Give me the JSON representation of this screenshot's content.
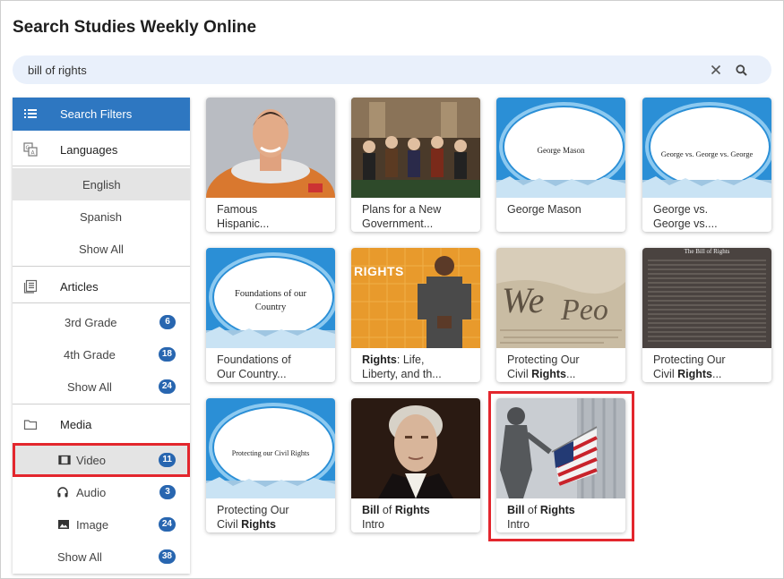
{
  "page": {
    "title": "Search Studies Weekly Online"
  },
  "search": {
    "value": "bill of rights"
  },
  "sidebar": {
    "filters_label": "Search Filters",
    "languages": {
      "label": "Languages",
      "items": [
        {
          "label": "English"
        },
        {
          "label": "Spanish"
        },
        {
          "label": "Show All"
        }
      ]
    },
    "articles": {
      "label": "Articles",
      "items": [
        {
          "label": "3rd Grade",
          "count": "6"
        },
        {
          "label": "4th Grade",
          "count": "18"
        },
        {
          "label": "Show All",
          "count": "24"
        }
      ]
    },
    "media": {
      "label": "Media",
      "items": [
        {
          "label": "Video",
          "count": "11"
        },
        {
          "label": "Audio",
          "count": "3"
        },
        {
          "label": "Image",
          "count": "24"
        },
        {
          "label": "Show All",
          "count": "38"
        }
      ]
    }
  },
  "results": [
    {
      "line1": "Famous",
      "line2": "Hispanic..."
    },
    {
      "line1": "Plans for a New",
      "line2": "Government..."
    },
    {
      "line1": "George Mason",
      "line2": "",
      "slide_text": "George Mason"
    },
    {
      "line1": "George vs.",
      "line2": "George vs....",
      "slide_text": "George vs. George vs. George"
    },
    {
      "line1": "Foundations of",
      "line2": "Our Country...",
      "slide_text_1": "Foundations of our",
      "slide_text_2": "Country"
    },
    {
      "line1_bold": "Rights",
      "line1_rest": ": Life,",
      "line2": "Liberty, and th...",
      "thumb_text": "RIGHTS"
    },
    {
      "line1": "Protecting Our",
      "line2_pre": "Civil ",
      "line2_bold": "Rights",
      "line2_post": "..."
    },
    {
      "line1": "Protecting Our",
      "line2_pre": "Civil ",
      "line2_bold": "Rights",
      "line2_post": "...",
      "doc_title": "The Bill of Rights"
    },
    {
      "line1": "Protecting Our",
      "line2_pre": "Civil ",
      "line2_bold": "Rights",
      "slide_text": "Protecting our Civil Rights"
    },
    {
      "l1a": "Bill",
      "l1b": " of ",
      "l1c": "Rights",
      "line2": "Intro"
    },
    {
      "l1a": "Bill",
      "l1b": " of ",
      "l1c": "Rights",
      "line2": "Intro"
    }
  ],
  "colors": {
    "accent": "#2e77c1",
    "badge": "#2866b0",
    "highlight": "#e3262d"
  }
}
